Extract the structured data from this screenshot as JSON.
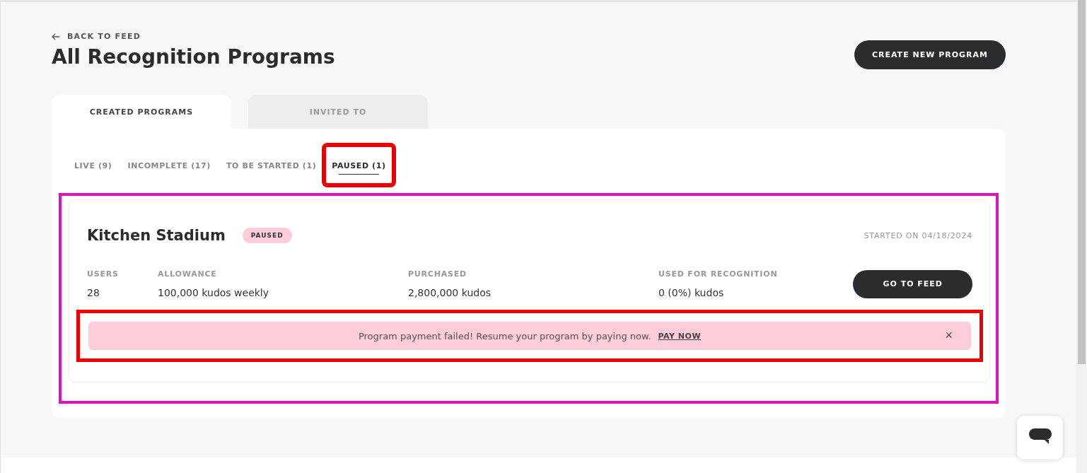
{
  "back_link": "BACK TO FEED",
  "title": "All Recognition Programs",
  "create_button": "CREATE NEW PROGRAM",
  "tabs": [
    {
      "label": "CREATED PROGRAMS",
      "selected": true
    },
    {
      "label": "INVITED TO",
      "selected": false
    }
  ],
  "filters": [
    {
      "label": "LIVE (9)",
      "selected": false
    },
    {
      "label": "INCOMPLETE (17)",
      "selected": false
    },
    {
      "label": "TO BE STARTED (1)",
      "selected": false
    },
    {
      "label": "PAUSED (1)",
      "selected": true
    }
  ],
  "programs": [
    {
      "name": "Kitchen Stadium",
      "status": "PAUSED",
      "started": "STARTED ON 04/18/2024",
      "stats": [
        {
          "label": "USERS",
          "value": "28"
        },
        {
          "label": "ALLOWANCE",
          "value": "100,000 kudos weekly"
        },
        {
          "label": "PURCHASED",
          "value": "2,800,000 kudos"
        },
        {
          "label": "USED FOR RECOGNITION",
          "value": "0 (0%) kudos"
        }
      ],
      "button": "GO TO FEED",
      "alert": {
        "message": "Program payment failed! Resume your program by paying now.",
        "link": "PAY NOW",
        "close": "×"
      }
    }
  ]
}
